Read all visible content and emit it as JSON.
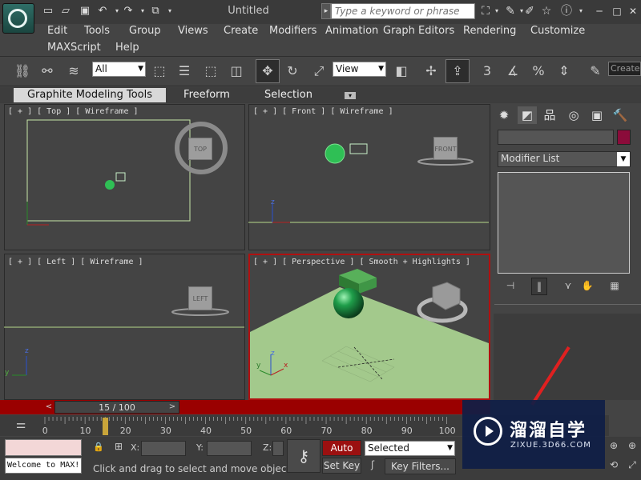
{
  "app": {
    "title": "Untitled"
  },
  "search": {
    "placeholder": "Type a keyword or phrase"
  },
  "menus": [
    "Edit",
    "Tools",
    "Group",
    "Views",
    "Create",
    "Modifiers",
    "Animation",
    "Graph Editors",
    "Rendering",
    "Customize",
    "MAXScript",
    "Help"
  ],
  "toolbar": {
    "selection_filter": "All",
    "ref_coord": "View",
    "create_label": "Create"
  },
  "ribbon": {
    "tabs": [
      "Graphite Modeling Tools",
      "Freeform",
      "Selection"
    ]
  },
  "viewports": {
    "top": {
      "label": "[ + ] [ Top ] [ Wireframe ]",
      "cube": "TOP"
    },
    "front": {
      "label": "[ + ] [ Front ] [ Wireframe ]",
      "cube": "FRONT"
    },
    "left": {
      "label": "[ + ] [ Left ] [ Wireframe ]",
      "cube": "LEFT"
    },
    "perspective": {
      "label": "[ + ] [ Perspective ] [ Smooth + Highlights ]"
    },
    "axes": {
      "x": "x",
      "y": "y",
      "z": "z"
    }
  },
  "command_panel": {
    "modifier_list": "Modifier List",
    "accent_color": "#8b0b3a"
  },
  "timeline": {
    "frame_display": "15 / 100",
    "current_frame": 15,
    "ticks": [
      "0",
      "10",
      "20",
      "30",
      "40",
      "50",
      "60",
      "70",
      "80",
      "90",
      "100"
    ]
  },
  "status": {
    "maxscript_text": "Welcome to MAX!",
    "message": "Click and drag to select and move objects",
    "x_label": "X:",
    "y_label": "Y:",
    "z_label": "Z:",
    "auto_key": "Auto Key",
    "set_key": "Set Key",
    "selected_option": "Selected",
    "key_filters": "Key Filters..."
  },
  "watermark": {
    "brand": "溜溜自学",
    "url": "ZIXUE.3D66.COM"
  }
}
